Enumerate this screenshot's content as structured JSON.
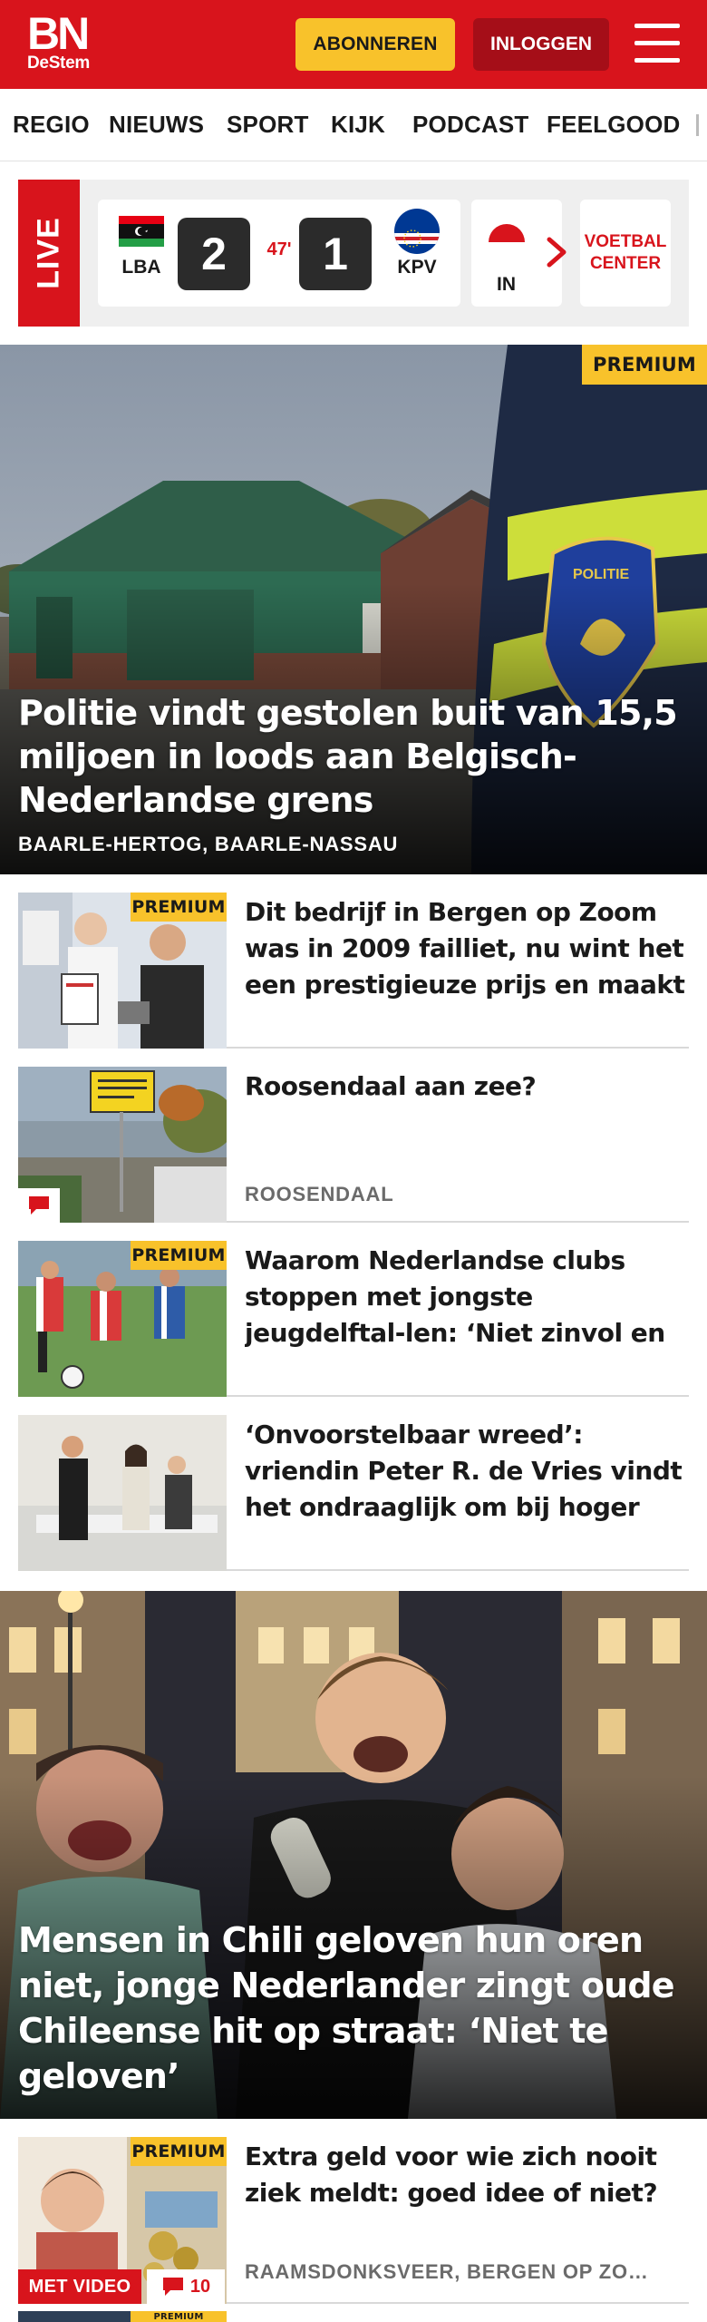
{
  "header": {
    "logo_main": "BN",
    "logo_sub": "DeStem",
    "subscribe_label": "ABONNEREN",
    "login_label": "INLOGGEN",
    "brand_color": "#d8141c"
  },
  "nav": {
    "items": [
      "REGIO",
      "NIEUWS",
      "SPORT",
      "KIJK",
      "PODCAST",
      "FEELGOOD"
    ]
  },
  "live": {
    "label": "LIVE",
    "match": {
      "home_code": "LBA",
      "home_score": "2",
      "minute": "47'",
      "away_score": "1",
      "away_code": "KPV"
    },
    "next_match_partial_code": "IN",
    "voetbal_center_label": "VOETBAL CENTER"
  },
  "hero": {
    "premium_label": "PREMIUM",
    "title": "Politie vindt gestolen buit van 15,5 miljoen in loods aan Belgisch-Nederlandse grens",
    "location": "BAARLE-HERTOG, BAARLE-NASSAU"
  },
  "articles": [
    {
      "premium_label": "PREMIUM",
      "title": "Dit bedrijf in Bergen op Zoom was in 2009 failliet, nu wint het een prestigieuze prijs en maakt het…",
      "location": ""
    },
    {
      "premium_label": "",
      "title": "Roosendaal aan zee?",
      "location": "ROOSENDAAL"
    },
    {
      "premium_label": "PREMIUM",
      "title": "Waarom Nederlandse clubs stoppen met jongste jeugdelftal-len: ‘Niet zinvol en sociaal niet…",
      "location": ""
    },
    {
      "premium_label": "",
      "title": "‘Onvoorstelbaar wreed’: vriendin Peter R. de Vries vindt het ondraaglijk om bij hoger beroep…",
      "location": ""
    }
  ],
  "hero2": {
    "title": "Mensen in Chili geloven hun oren niet, jonge Nederlander zingt oude Chileense hit op straat: ‘Niet te geloven’"
  },
  "article_video": {
    "premium_label": "PREMIUM",
    "title": "Extra geld voor wie zich nooit ziek meldt: goed idee of niet?",
    "location": "RAAMSDONKSVEER, BERGEN OP ZO…",
    "video_label": "MET VIDEO",
    "comment_count": "10"
  },
  "partial_next": {
    "premium_label": "PREMIUM"
  }
}
